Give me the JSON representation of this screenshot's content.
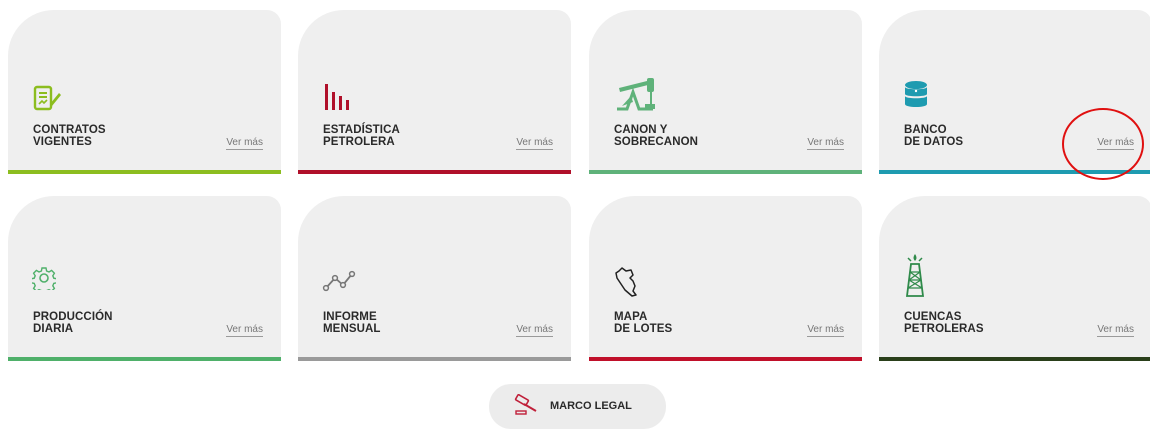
{
  "cards": [
    {
      "name": "contratos",
      "icon": "contract-pen-icon",
      "line1": "CONTRATOS",
      "line2": "VIGENTES",
      "more": "Ver más",
      "color": "#8cbd1f"
    },
    {
      "name": "estadistica",
      "icon": "bar-chart-icon",
      "line1": "ESTADÍSTICA",
      "line2": "PETROLERA",
      "more": "Ver más",
      "color": "#b0102a"
    },
    {
      "name": "canon",
      "icon": "oil-pumpjack-icon",
      "line1": "CANON Y",
      "line2": "SOBRECANON",
      "more": "Ver más",
      "color": "#5fb27a"
    },
    {
      "name": "banco",
      "icon": "database-icon",
      "line1": "BANCO",
      "line2": "DE DATOS",
      "more": "Ver más",
      "color": "#1e9bb0"
    },
    {
      "name": "produccion",
      "icon": "gear-icon",
      "line1": "PRODUCCIÓN",
      "line2": "DIARIA",
      "more": "Ver más",
      "color": "#4fb06a"
    },
    {
      "name": "informe",
      "icon": "line-graph-icon",
      "line1": "INFORME",
      "line2": "MENSUAL",
      "more": "Ver más",
      "color": "#9a9a9a"
    },
    {
      "name": "mapa",
      "icon": "peru-map-icon",
      "line1": "MAPA",
      "line2": "DE LOTES",
      "more": "Ver más",
      "color": "#c0102a"
    },
    {
      "name": "cuencas",
      "icon": "oil-derrick-icon",
      "line1": "CUENCAS",
      "line2": "PETROLERAS",
      "more": "Ver más",
      "color": "#2a3f1a"
    }
  ],
  "legal": {
    "label": "MARCO LEGAL",
    "icon": "gavel-icon"
  }
}
